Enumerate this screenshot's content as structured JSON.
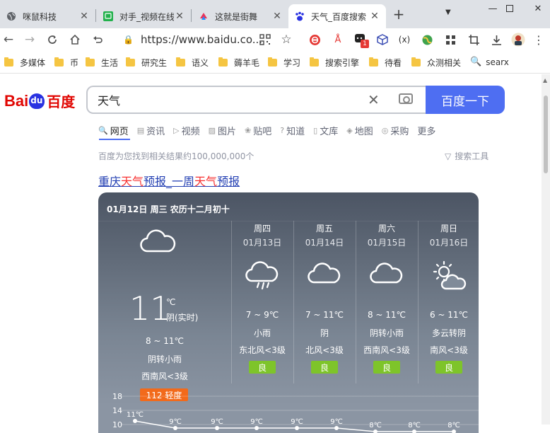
{
  "tabs": [
    {
      "title": "咪鼠科技",
      "icon": "globe-icon",
      "active": false
    },
    {
      "title": "对手_视频在线",
      "icon": "video-site-icon",
      "active": false
    },
    {
      "title": "这就是街舞",
      "icon": "show-icon",
      "active": false
    },
    {
      "title": "天气_百度搜索",
      "icon": "baidu-paw-icon",
      "active": true
    }
  ],
  "toolbar": {
    "url": "https://www.baidu.co...",
    "extension_badge": "1"
  },
  "bookmarks": [
    "多媒体",
    "币",
    "生活",
    "研究生",
    "语义",
    "薅羊毛",
    "学习",
    "搜索引擎",
    "待看",
    "众测相关",
    "searx"
  ],
  "search": {
    "logo_latin": "Bai",
    "logo_cn": "百度",
    "query": "天气",
    "button": "百度一下"
  },
  "nav": {
    "tabs": [
      "网页",
      "资讯",
      "视频",
      "图片",
      "贴吧",
      "知道",
      "文库",
      "地图",
      "采购",
      "更多"
    ],
    "active": "网页"
  },
  "results": {
    "count_text": "百度为您找到相关结果约100,000,000个",
    "tools": "搜索工具",
    "first_title_parts": [
      "重庆",
      "天气",
      "预报_一周",
      "天气",
      "预报"
    ]
  },
  "weather": {
    "date_line": "01月12日 周三 农历十二月初十",
    "today": {
      "temp": "11",
      "unit": "℃",
      "condition": "阴(实时)",
      "range": "8 ~ 11℃",
      "desc": "阴转小雨",
      "wind": "西南风<3级",
      "aqi": "112  轻度",
      "icon": "cloud-icon"
    },
    "days": [
      {
        "weekday": "周四",
        "date": "01月13日",
        "icon": "rain-cloud-icon",
        "range": "7 ~ 9℃",
        "desc": "小雨",
        "wind": "东北风<3级",
        "aqi": "良"
      },
      {
        "weekday": "周五",
        "date": "01月14日",
        "icon": "cloud-icon",
        "range": "7 ~ 11℃",
        "desc": "阴",
        "wind": "北风<3级",
        "aqi": "良"
      },
      {
        "weekday": "周六",
        "date": "01月15日",
        "icon": "cloud-icon",
        "range": "8 ~ 11℃",
        "desc": "阴转小雨",
        "wind": "西南风<3级",
        "aqi": "良"
      },
      {
        "weekday": "周日",
        "date": "01月16日",
        "icon": "sun-cloud-icon",
        "range": "6 ~ 11℃",
        "desc": "多云转阴",
        "wind": "南风<3级",
        "aqi": "良"
      }
    ]
  },
  "chart_data": {
    "type": "line",
    "y_ticks": [
      18,
      14,
      10
    ],
    "ylim": [
      10,
      18
    ],
    "values": [
      11,
      9,
      9,
      9,
      9,
      9,
      8,
      8,
      8
    ],
    "point_labels": [
      "11℃",
      "9℃",
      "9℃",
      "9℃",
      "9℃",
      "9℃",
      "8℃",
      "8℃",
      "8℃"
    ]
  }
}
